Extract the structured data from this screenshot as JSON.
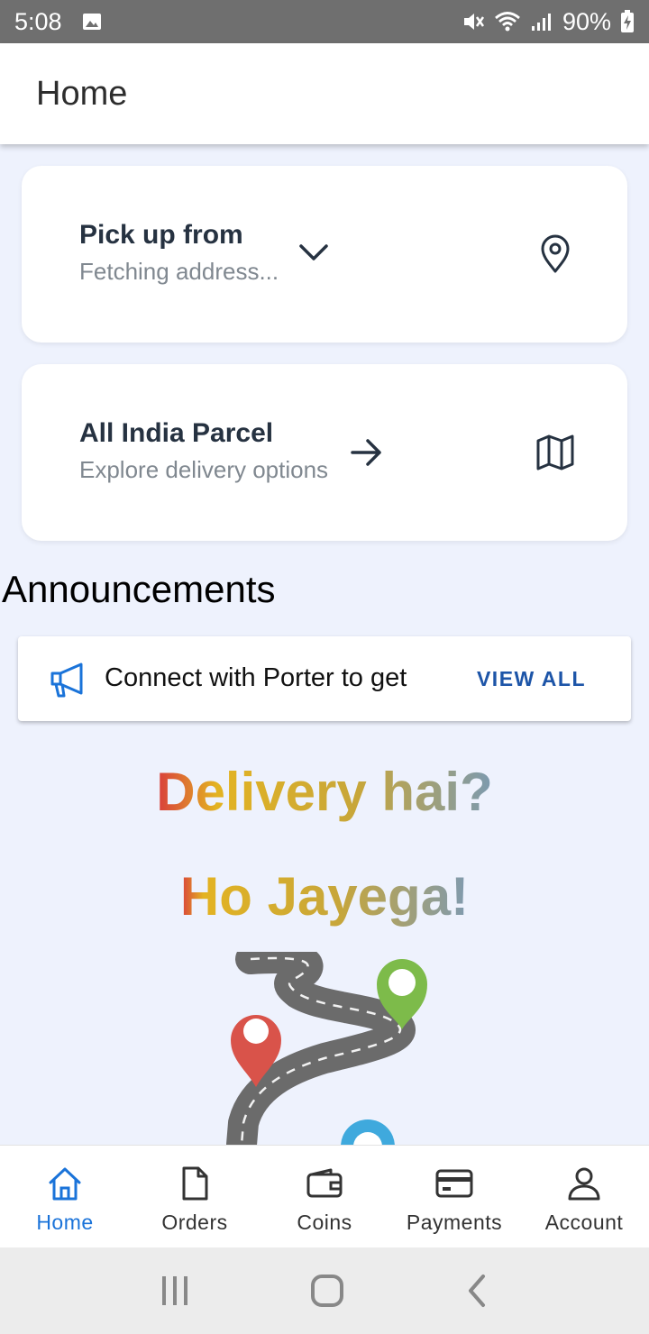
{
  "status_bar": {
    "time": "5:08",
    "battery": "90%"
  },
  "header": {
    "title": "Home"
  },
  "pickup_card": {
    "title": "Pick up from",
    "subtitle": "Fetching address..."
  },
  "parcel_card": {
    "title": "All India Parcel",
    "subtitle": "Explore delivery options"
  },
  "announcements": {
    "heading": "Announcements",
    "message": "Connect with Porter to get",
    "view_all": "VIEW ALL"
  },
  "promo": {
    "line1": "Delivery hai?",
    "line2": "Ho Jayega!"
  },
  "bottom_nav": {
    "items": [
      {
        "label": "Home",
        "icon": "home-icon",
        "active": true
      },
      {
        "label": "Orders",
        "icon": "document-icon"
      },
      {
        "label": "Coins",
        "icon": "wallet-icon"
      },
      {
        "label": "Payments",
        "icon": "card-icon"
      },
      {
        "label": "Account",
        "icon": "person-icon"
      }
    ]
  },
  "colors": {
    "accent": "#1a73d9",
    "link": "#1d55a8",
    "background": "#eef2fd",
    "title_text": "#263241"
  }
}
